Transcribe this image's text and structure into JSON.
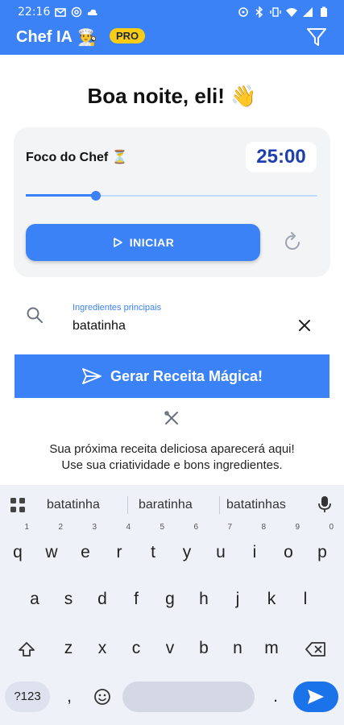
{
  "status": {
    "time": "22:16"
  },
  "app": {
    "title": "Chef IA",
    "chef_emoji": "👨‍🍳",
    "pro_label": "PRO"
  },
  "greeting": "Boa noite, eli! 👋",
  "focus": {
    "title": "Foco do Chef ⏳",
    "timer": "25:00",
    "slider_fraction": 0.24,
    "start_label": "INICIAR"
  },
  "ingredients": {
    "label": "Ingredientes principais",
    "value": "batatinha"
  },
  "generate_label": "Gerar Receita Mágica!",
  "empty_state": {
    "line1": "Sua próxima receita deliciosa aparecerá aqui!",
    "line2": "Use sua criatividade e bons ingredientes."
  },
  "keyboard": {
    "suggestions": [
      "batatinha",
      "baratinha",
      "batatinhas"
    ],
    "row1": [
      "q",
      "w",
      "e",
      "r",
      "t",
      "y",
      "u",
      "i",
      "o",
      "p"
    ],
    "row1_numbers": [
      "1",
      "2",
      "3",
      "4",
      "5",
      "6",
      "7",
      "8",
      "9",
      "0"
    ],
    "row2": [
      "a",
      "s",
      "d",
      "f",
      "g",
      "h",
      "j",
      "k",
      "l"
    ],
    "row3": [
      "z",
      "x",
      "c",
      "v",
      "b",
      "n",
      "m"
    ],
    "symbols_label": "?123",
    "comma": ",",
    "period": "."
  },
  "colors": {
    "primary": "#3b82f6",
    "pro": "#facc15",
    "timer_text": "#1e40af",
    "enter": "#1a73e8"
  }
}
